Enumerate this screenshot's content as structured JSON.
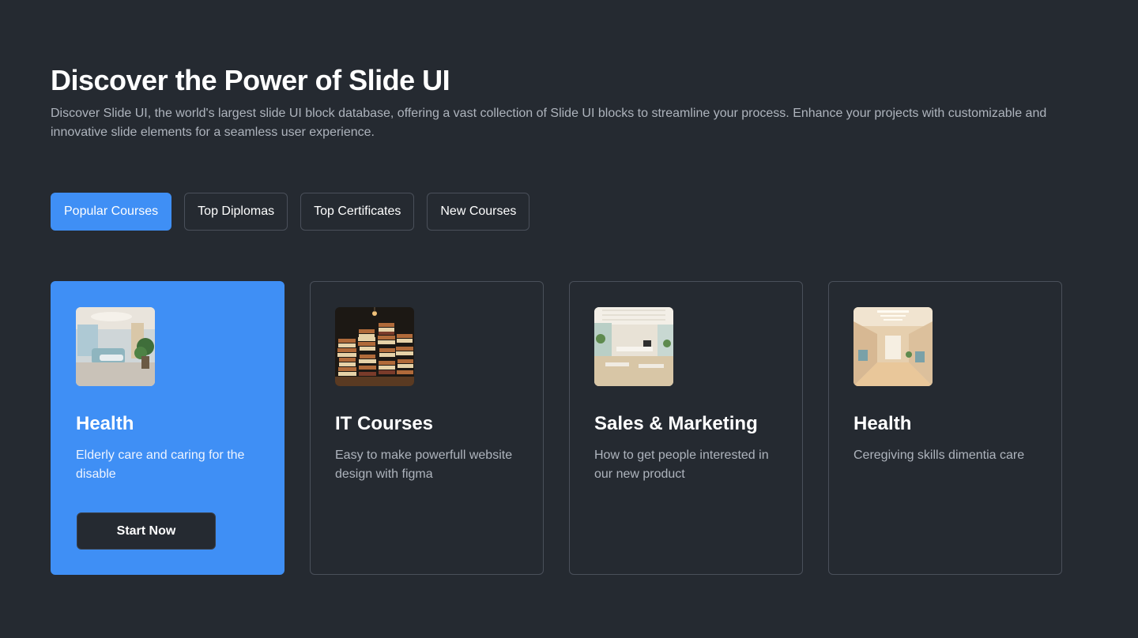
{
  "header": {
    "title": "Discover the Power of Slide UI",
    "description": "Discover Slide UI, the world's largest slide UI block database, offering a vast collection of Slide UI blocks to streamline your process. Enhance your projects with customizable and innovative slide elements for a seamless user experience."
  },
  "tabs": [
    {
      "label": "Popular Courses",
      "active": true
    },
    {
      "label": "Top Diplomas",
      "active": false
    },
    {
      "label": "Top Certificates",
      "active": false
    },
    {
      "label": "New Courses",
      "active": false
    }
  ],
  "cards": [
    {
      "title": "Health",
      "description": "Elderly care and caring for the disable",
      "button_label": "Start Now",
      "active": true,
      "image": "clinic-room-photo"
    },
    {
      "title": "IT Courses",
      "description": "Easy to make powerfull website design with figma",
      "active": false,
      "image": "book-stacks-photo"
    },
    {
      "title": "Sales & Marketing",
      "description": "How to get people interested in our new product",
      "active": false,
      "image": "office-space-photo"
    },
    {
      "title": "Health",
      "description": "Ceregiving skills dimentia care",
      "active": false,
      "image": "hospital-hallway-photo"
    }
  ],
  "colors": {
    "background": "#252a31",
    "accent": "#3f8ff5",
    "muted_text": "#aeb4bd",
    "border": "#4a505a"
  }
}
